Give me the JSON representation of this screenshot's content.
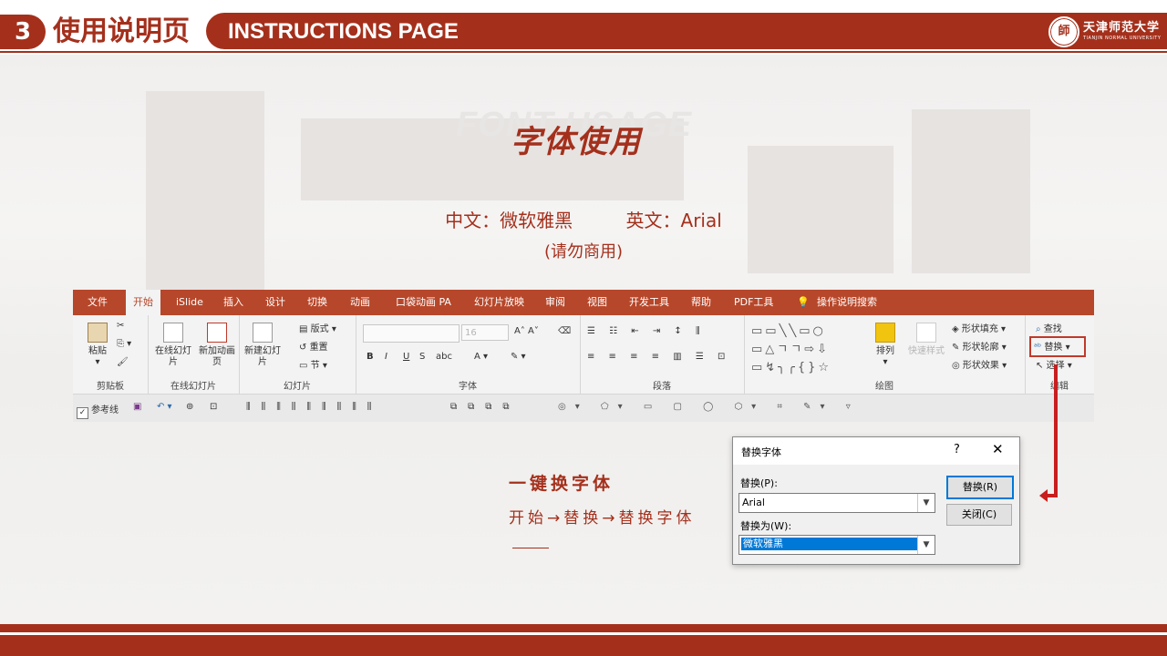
{
  "header": {
    "number": "3",
    "title_cn": "使用说明页",
    "title_en": "INSTRUCTIONS PAGE",
    "logo_name": "天津师范大学",
    "logo_sub": "TIANJIN NORMAL UNIVERSITY",
    "seal_glyph": "師"
  },
  "slide": {
    "watermark": "FONT USAGE",
    "title": "字体使用",
    "font_cn": "中文：微软雅黑",
    "font_en": "英文：Arial",
    "note": "(请勿商用)",
    "one_key_title": "一键换字体",
    "one_key_steps": "开始→替换→替换字体"
  },
  "ribbon": {
    "tabs": [
      "文件",
      "开始",
      "iSlide",
      "插入",
      "设计",
      "切换",
      "动画",
      "口袋动画 PA",
      "幻灯片放映",
      "审阅",
      "视图",
      "开发工具",
      "帮助",
      "PDF工具",
      "操作说明搜索"
    ],
    "active_tab": "开始",
    "groups": {
      "clipboard": {
        "label": "剪贴板",
        "paste": "粘贴"
      },
      "online_slides": {
        "label": "在线幻灯片",
        "online": "在线幻灯片",
        "new_page": "新加动画页"
      },
      "slides": {
        "label": "幻灯片",
        "new_slide": "新建幻灯片",
        "layout": "版式",
        "reset": "重置",
        "section": "节"
      },
      "font": {
        "label": "字体",
        "size": "16",
        "bold": "B",
        "italic": "I",
        "underline": "U",
        "strike": "S",
        "spacing": "abc"
      },
      "paragraph": {
        "label": "段落"
      },
      "drawing": {
        "label": "绘图",
        "arrange": "排列",
        "quick_styles": "快速样式",
        "fill": "形状填充",
        "outline": "形状轮廓",
        "effects": "形状效果"
      },
      "editing": {
        "label": "编辑",
        "find": "查找",
        "replace": "替换",
        "select": "选择"
      }
    },
    "quick_access": {
      "guides": "参考线"
    }
  },
  "dialog": {
    "title": "替换字体",
    "help": "?",
    "close": "✕",
    "replace_label": "替换(P):",
    "replace_value": "Arial",
    "with_label": "替换为(W):",
    "with_value": "微软雅黑",
    "replace_button": "替换(R)",
    "close_button": "关闭(C)"
  }
}
